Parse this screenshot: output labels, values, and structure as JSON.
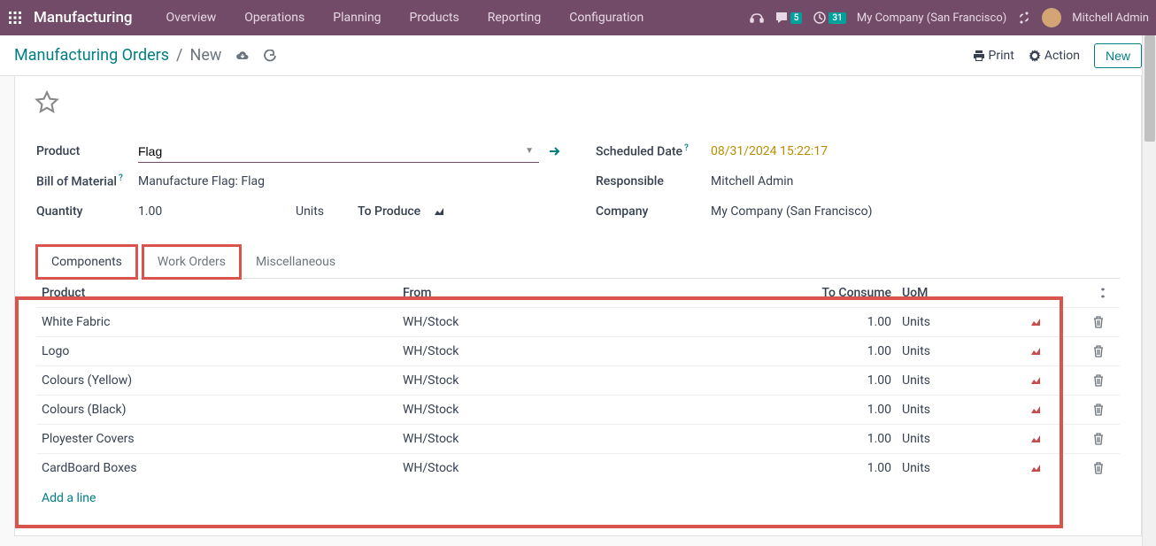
{
  "navbar": {
    "app_title": "Manufacturing",
    "menu": [
      "Overview",
      "Operations",
      "Planning",
      "Products",
      "Reporting",
      "Configuration"
    ],
    "messages_badge": "5",
    "activities_badge": "31",
    "company": "My Company (San Francisco)",
    "user": "Mitchell Admin"
  },
  "breadcrumb": {
    "root": "Manufacturing Orders",
    "current": "New",
    "print_label": "Print",
    "action_label": "Action",
    "new_btn": "New"
  },
  "form": {
    "left": {
      "product_label": "Product",
      "product_value": "Flag",
      "bom_label": "Bill of Material",
      "bom_value": "Manufacture Flag: Flag",
      "qty_label": "Quantity",
      "qty_value": "1.00",
      "qty_unit": "Units",
      "to_produce_label": "To Produce"
    },
    "right": {
      "scheduled_label": "Scheduled Date",
      "scheduled_value": "08/31/2024 15:22:17",
      "responsible_label": "Responsible",
      "responsible_value": "Mitchell Admin",
      "company_label": "Company",
      "company_value": "My Company (San Francisco)"
    }
  },
  "tabs": [
    "Components",
    "Work Orders",
    "Miscellaneous"
  ],
  "table": {
    "headers": {
      "product": "Product",
      "from": "From",
      "to_consume": "To Consume",
      "uom": "UoM"
    },
    "rows": [
      {
        "product": "White Fabric",
        "from": "WH/Stock",
        "to_consume": "1.00",
        "uom": "Units"
      },
      {
        "product": "Logo",
        "from": "WH/Stock",
        "to_consume": "1.00",
        "uom": "Units"
      },
      {
        "product": "Colours (Yellow)",
        "from": "WH/Stock",
        "to_consume": "1.00",
        "uom": "Units"
      },
      {
        "product": "Colours (Black)",
        "from": "WH/Stock",
        "to_consume": "1.00",
        "uom": "Units"
      },
      {
        "product": "Ployester Covers",
        "from": "WH/Stock",
        "to_consume": "1.00",
        "uom": "Units"
      },
      {
        "product": "CardBoard Boxes",
        "from": "WH/Stock",
        "to_consume": "1.00",
        "uom": "Units"
      }
    ],
    "add_line": "Add a line"
  }
}
